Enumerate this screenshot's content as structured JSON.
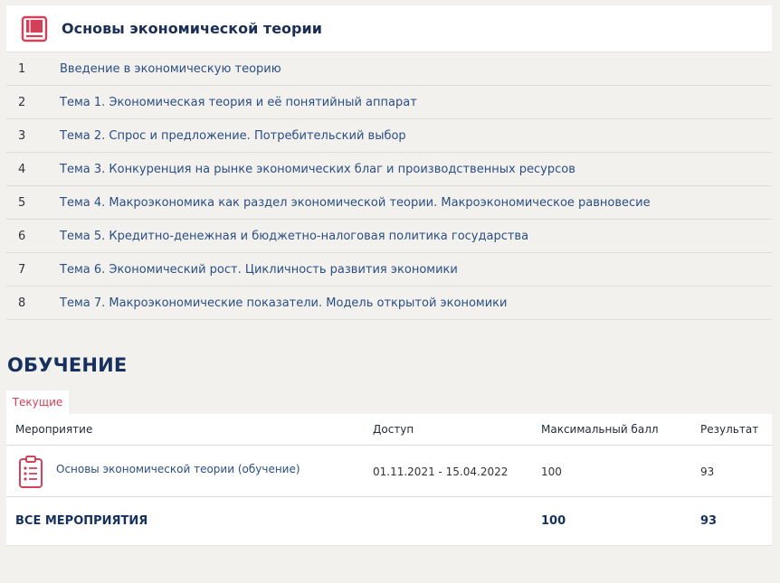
{
  "course": {
    "title": "Основы экономической теории",
    "icon": "book-icon",
    "accent": "#d44057"
  },
  "topics": [
    {
      "num": "1",
      "title": "Введение в экономическую теорию"
    },
    {
      "num": "2",
      "title": "Тема 1. Экономическая теория и её понятийный аппарат"
    },
    {
      "num": "3",
      "title": "Тема 2. Спрос и предложение. Потребительский выбор"
    },
    {
      "num": "4",
      "title": "Тема 3. Конкуренция на рынке экономических благ и производственных ресурсов"
    },
    {
      "num": "5",
      "title": "Тема 4. Макроэкономика как раздел экономической теории. Макроэкономическое равновесие"
    },
    {
      "num": "6",
      "title": "Тема 5. Кредитно-денежная и бюджетно-налоговая политика государства"
    },
    {
      "num": "7",
      "title": "Тема 6. Экономический рост. Цикличность развития экономики"
    },
    {
      "num": "8",
      "title": "Тема 7. Макроэкономические показатели. Модель открытой экономики"
    }
  ],
  "learning": {
    "section_title": "ОБУЧЕНИЕ",
    "tab_current": "Текущие",
    "columns": {
      "event": "Мероприятие",
      "access": "Доступ",
      "max_score": "Максимальный балл",
      "result": "Результат"
    },
    "rows": [
      {
        "icon": "clipboard-icon",
        "event": "Основы экономической теории (обучение)",
        "access": "01.11.2021 - 15.04.2022",
        "max_score": "100",
        "result": "93"
      }
    ],
    "total": {
      "label": "ВСЕ МЕРОПРИЯТИЯ",
      "max_score": "100",
      "result": "93"
    }
  }
}
